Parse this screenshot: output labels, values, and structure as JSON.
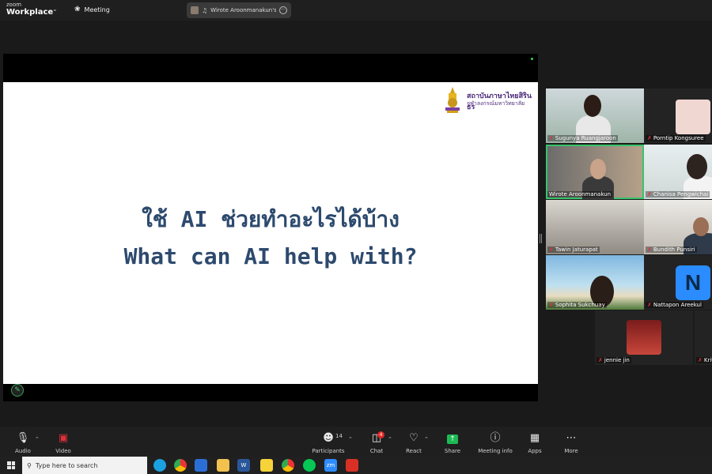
{
  "topbar": {
    "brand_small": "zoom",
    "brand_main": "Workplace",
    "meeting_label": "Meeting",
    "share_tab_label": "Wirote Aroonmanakun's scre"
  },
  "slide": {
    "institution_name": "สถาบันภาษาไทยสิรินธร",
    "institution_sub": "จุฬาลงกรณ์มหาวิทยาลัย",
    "title_th": "ใช้ AI ช่วยทำอะไรได้บ้าง",
    "title_en": "What can AI help with?"
  },
  "participants": [
    {
      "name": "Sugunya Ruangjaroon"
    },
    {
      "name": "Porntip Kongsuree"
    },
    {
      "name": "Wirote Aroonmanakun"
    },
    {
      "name": "Chanisa Pengwichai"
    },
    {
      "name": "Tawin Jaturapat"
    },
    {
      "name": "Bundith Punsiri"
    },
    {
      "name": "Sophita Sukchuay"
    },
    {
      "name": "Nattapon Areekul",
      "avatar_letter": "N"
    },
    {
      "name": "jennie jin"
    },
    {
      "name": "Krit"
    }
  ],
  "toolbar": {
    "audio": "Audio",
    "video": "Video",
    "participants": "Participants",
    "participants_count": "14",
    "chat": "Chat",
    "chat_badge": "4",
    "react": "React",
    "share": "Share",
    "meeting_info": "Meeting info",
    "apps": "Apps",
    "more": "More"
  },
  "taskbar": {
    "search_placeholder": "Type here to search"
  },
  "colors": {
    "active_speaker_border": "#37c46b",
    "slide_title": "#2d4a6e",
    "institution": "#4b2a7a",
    "share_green": "#1db954",
    "muted_red": "#e0303a"
  }
}
